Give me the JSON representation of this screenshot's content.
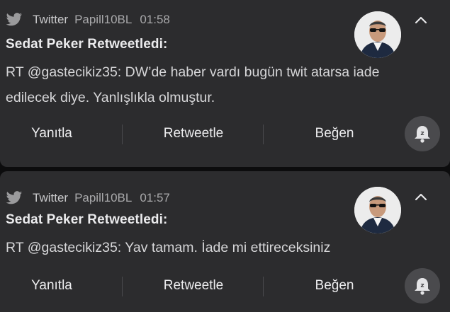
{
  "notifications": [
    {
      "app_name": "Twitter",
      "account": "Papill10BL",
      "time": "01:58",
      "title": "Sedat Peker Retweetledi:",
      "message": "RT @gastecikiz35: DW’de haber vardı bugün twit atarsa iade edilecek diye. Yanlışlıkla olmuştur.",
      "actions": {
        "reply": "Yanıtla",
        "retweet": "Retweetle",
        "like": "Beğen"
      }
    },
    {
      "app_name": "Twitter",
      "account": "Papill10BL",
      "time": "01:57",
      "title": "Sedat Peker Retweetledi:",
      "message": "RT @gastecikiz35: Yav tamam. İade mi ettireceksiniz",
      "actions": {
        "reply": "Yanıtla",
        "retweet": "Retweetle",
        "like": "Beğen"
      }
    }
  ],
  "icons": {
    "app": "twitter-bird-icon",
    "expand": "chevron-up-icon",
    "snooze": "snooze-bell-icon",
    "avatar": "profile-photo"
  },
  "colors": {
    "card_background": "#2c2c2e",
    "screen_background": "#0c0c0d",
    "snooze_button": "#4a4a4d"
  }
}
